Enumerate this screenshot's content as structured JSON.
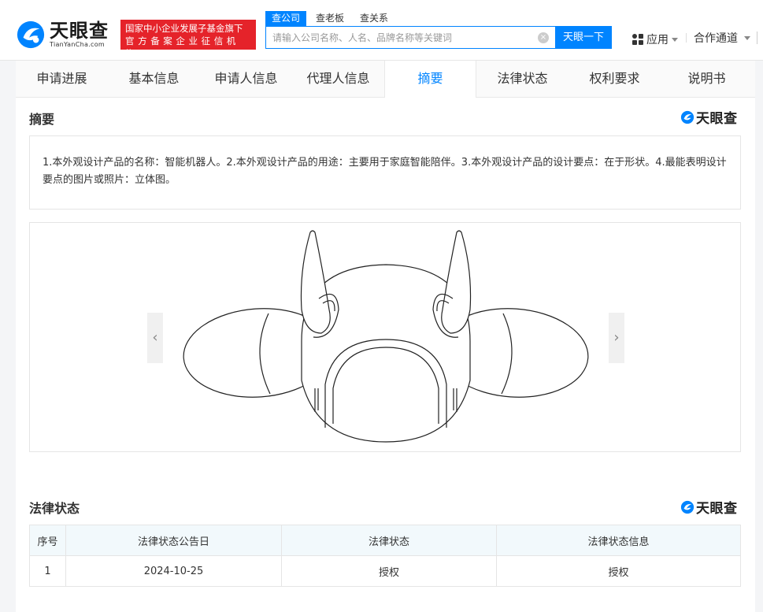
{
  "header": {
    "logo_cn": "天眼查",
    "logo_en": "TianYanCha.com",
    "badge_line1": "国家中小企业发展子基金旗下",
    "badge_line2": "官方备案企业征信机构",
    "search_tabs": [
      {
        "label": "查公司"
      },
      {
        "label": "查老板"
      },
      {
        "label": "查关系"
      }
    ],
    "search_placeholder": "请输入公司名称、人名、品牌名称等关键词",
    "search_button": "天眼一下",
    "apps_label": "应用",
    "partner_label": "合作通道"
  },
  "nav": {
    "tabs": [
      {
        "label": "申请进展"
      },
      {
        "label": "基本信息"
      },
      {
        "label": "申请人信息"
      },
      {
        "label": "代理人信息"
      },
      {
        "label": "摘要"
      },
      {
        "label": "法律状态"
      },
      {
        "label": "权利要求"
      },
      {
        "label": "说明书"
      }
    ]
  },
  "abstract": {
    "title": "摘要",
    "watermark": "天眼查",
    "text": "1.本外观设计产品的名称：智能机器人。2.本外观设计产品的用途：主要用于家庭智能陪伴。3.本外观设计产品的设计要点：在于形状。4.最能表明设计要点的图片或照片：立体图。",
    "prev_arrow": "‹",
    "next_arrow": "›"
  },
  "legal": {
    "title": "法律状态",
    "watermark": "天眼查",
    "columns": [
      "序号",
      "法律状态公告日",
      "法律状态",
      "法律状态信息"
    ],
    "rows": [
      [
        "1",
        "2024-10-25",
        "授权",
        "授权"
      ]
    ]
  },
  "colors": {
    "accent": "#0084ff",
    "badge_red": "#e5232a"
  }
}
